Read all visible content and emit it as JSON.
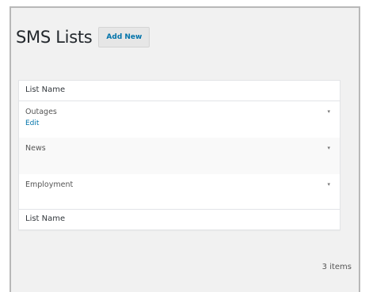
{
  "page": {
    "title": "SMS Lists",
    "add_new_label": "Add New"
  },
  "table": {
    "header": "List Name",
    "footer": "List Name",
    "rows": [
      {
        "name": "Outages",
        "edit": "Edit",
        "toggle": "▾"
      },
      {
        "name": "News",
        "toggle": "▾"
      },
      {
        "name": "Employment",
        "toggle": "▾"
      }
    ]
  },
  "count_label": "3 items"
}
